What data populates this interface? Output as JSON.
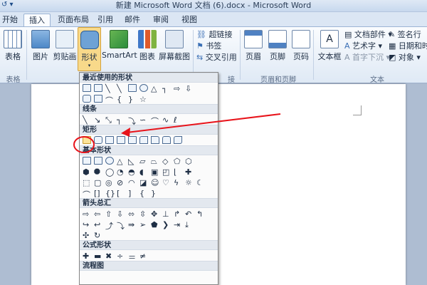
{
  "window": {
    "title": "新建 Microsoft Word 文档 (6).docx - Microsoft Word"
  },
  "tabs": [
    "开始",
    "插入",
    "页面布局",
    "引用",
    "邮件",
    "审阅",
    "视图"
  ],
  "ribbon": {
    "table_label": "表格",
    "picture_label": "图片",
    "clipart_label": "剪贴画",
    "shapes_label": "形状",
    "smartart_label": "SmartArt",
    "chart_label": "图表",
    "screenshot_label": "屏幕截图",
    "hyperlink_label": "超链接",
    "bookmark_label": "书签",
    "crossref_label": "交叉引用",
    "header_label": "页眉",
    "footer_label": "页脚",
    "pagenum_label": "页码",
    "textbox_label": "文本框",
    "quickparts_label": "文档部件",
    "wordart_label": "艺术字",
    "dropcap_label": "首字下沉",
    "signature_label": "签名行",
    "datetime_label": "日期和时",
    "object_label": "对象",
    "group_tables": "表格",
    "group_links": "接",
    "group_headerfooter": "页眉和页脚",
    "group_text": "文本"
  },
  "menu": {
    "sections": [
      "最近使用的形状",
      "线条",
      "矩形",
      "基本形状",
      "箭头总汇",
      "公式形状",
      "流程图"
    ]
  },
  "annotation": {
    "arrow_color": "#e8141b"
  }
}
